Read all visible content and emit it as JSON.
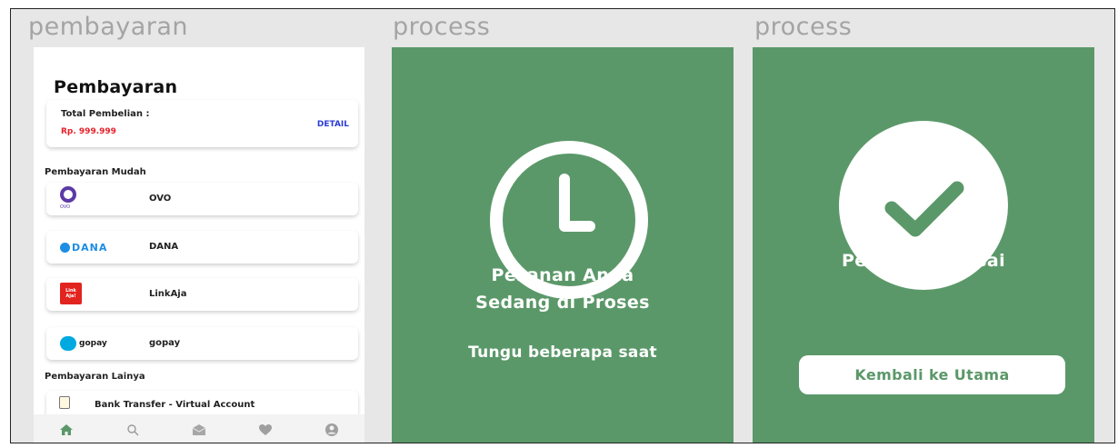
{
  "frames": {
    "payment_title": "pembayaran",
    "process_title_1": "process",
    "process_title_2": "process"
  },
  "payment": {
    "heading": "Pembayaran",
    "total_label": "Total Pembelian :",
    "total_amount": "Rp. 999.999",
    "detail_label": "DETAIL",
    "easy_section": "Pembayaran Mudah",
    "other_section": "Pembayaran Lainya",
    "methods": [
      {
        "name": "OVO",
        "logo_text": "OVO",
        "icon": "ovo-logo-icon"
      },
      {
        "name": "DANA",
        "logo_text": "DANA",
        "icon": "dana-logo-icon"
      },
      {
        "name": "LinkAja",
        "logo_text": "Link Aja!",
        "icon": "linkaja-logo-icon"
      },
      {
        "name": "gopay",
        "logo_text": "gopay",
        "icon": "gopay-logo-icon"
      }
    ],
    "bank_transfer": "Bank Transfer - Virtual Account",
    "nav": [
      "home-icon",
      "search-icon",
      "inbox-icon",
      "heart-icon",
      "profile-icon"
    ]
  },
  "processing": {
    "message": "Pesanan Anda Sedang di Proses",
    "message_line1": "Pesanan Anda",
    "message_line2": "Sedang di Proses",
    "wait_text": "Tungu beberapa saat",
    "icon": "clock-icon"
  },
  "done": {
    "message": "Pesanan Selesai",
    "button_label": "Kembali ke Utama",
    "icon": "check-icon"
  },
  "colors": {
    "green": "#5b9869",
    "price_red": "#e5202a",
    "detail_blue": "#2b3ad8",
    "title_gray": "#a4a4a4"
  }
}
